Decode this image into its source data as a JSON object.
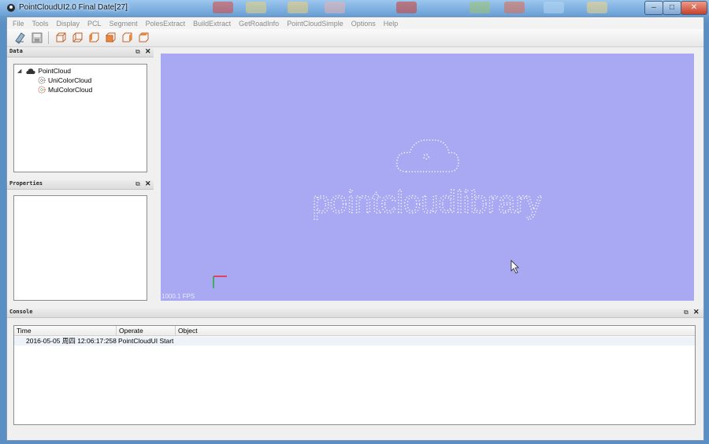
{
  "window": {
    "title": "PointCloudUI2.0  Final Date[27]",
    "controls": {
      "minimize": "–",
      "maximize": "□",
      "close": "✕"
    }
  },
  "menu": [
    "File",
    "Tools",
    "Display",
    "PCL",
    "Segment",
    "PolesExtract",
    "BuildExtract",
    "GetRoadInfo",
    "PointCloudSimple",
    "Options",
    "Help"
  ],
  "toolbar": {
    "icons": [
      "open-icon",
      "save-icon",
      "view-front-icon",
      "view-back-icon",
      "view-left-icon",
      "view-right-icon",
      "view-top-icon",
      "view-bottom-icon"
    ]
  },
  "data_panel": {
    "title": "Data",
    "float_glyph": "⧉",
    "close_glyph": "✕",
    "tree": {
      "root": "PointCloud",
      "children": [
        "UniColorCloud",
        "MulColorCloud"
      ]
    }
  },
  "properties_panel": {
    "title": "Properties",
    "float_glyph": "⧉",
    "close_glyph": "✕"
  },
  "viewport": {
    "background": "#a8a9f2",
    "logo_text": "pointcloudlibrary",
    "fps": "1000.1 FPS"
  },
  "console": {
    "title": "Console",
    "float_glyph": "⧉",
    "close_glyph": "✕",
    "columns": [
      "Time",
      "Operate",
      "Object"
    ],
    "rows": [
      {
        "time": "2016-05-05 周四 12:06:17:258",
        "operate": "PointCloudUI Start",
        "object": ""
      }
    ]
  },
  "colors": {
    "accent": "#6aa0d6",
    "viewport": "#a8a9f2",
    "close_button": "#c5412b"
  }
}
